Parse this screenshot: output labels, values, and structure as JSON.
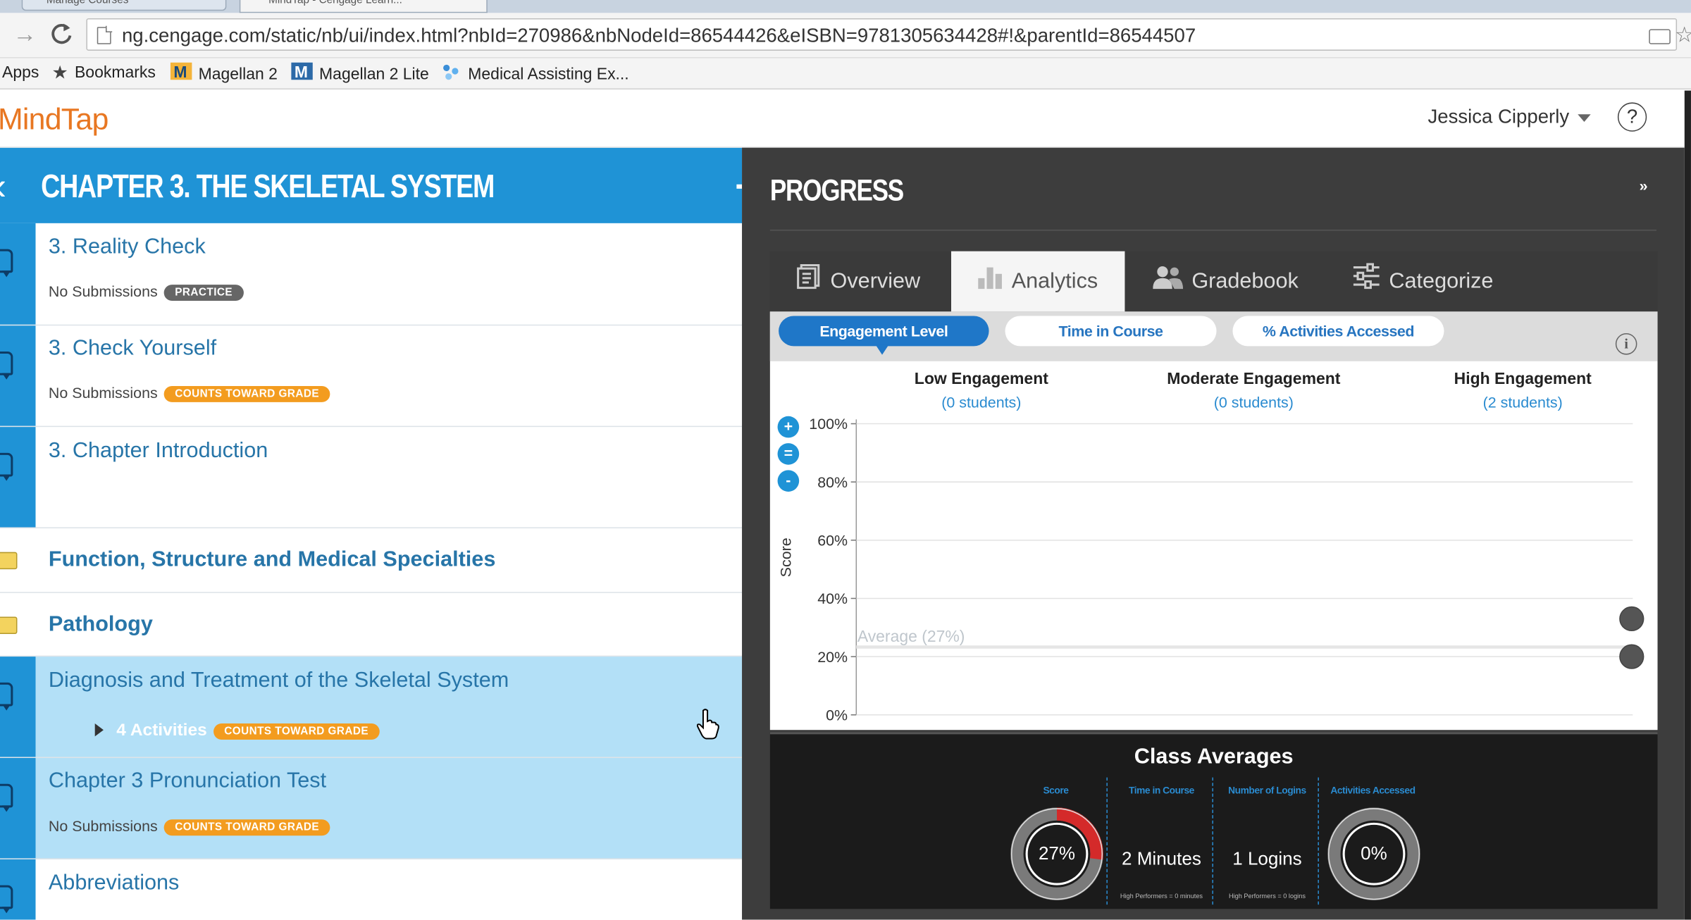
{
  "browser": {
    "tabs": [
      "Manage Courses",
      "MindTap - Cengage Learn..."
    ],
    "url": "ng.cengage.com/static/nb/ui/index.html?nbId=270986&nbNodeId=86544426&eISBN=9781305634428#!&parentId=86544507",
    "bookmarks": [
      {
        "label": "Apps",
        "icon": "apps-icon"
      },
      {
        "label": "Bookmarks",
        "icon": "star-icon"
      },
      {
        "label": "Magellan 2",
        "icon": "magellan-icon"
      },
      {
        "label": "Magellan 2 Lite",
        "icon": "magellan-lite-icon"
      },
      {
        "label": "Medical Assisting Ex...",
        "icon": "medical-assisting-icon"
      }
    ]
  },
  "header": {
    "logo": "MindTap",
    "user_name": "Jessica Cipperly",
    "help": "?"
  },
  "chapter": {
    "title": "CHAPTER 3. THE SKELETAL SYSTEM",
    "items": [
      {
        "name": "3. Reality Check",
        "sub": "No Submissions",
        "badge": "PRACTICE"
      },
      {
        "name": "3. Check Yourself",
        "sub": "No Submissions",
        "badge": "COUNTS TOWARD GRADE"
      },
      {
        "name": "3. Chapter Introduction"
      },
      {
        "name": "Function, Structure and Medical Specialties"
      },
      {
        "name": "Pathology"
      },
      {
        "name": "Diagnosis and Treatment of the Skeletal System",
        "activities": "4 Activities",
        "badge": "COUNTS TOWARD GRADE"
      },
      {
        "name": "Chapter 3 Pronunciation Test",
        "sub": "No Submissions",
        "badge": "COUNTS TOWARD GRADE"
      },
      {
        "name": "Abbreviations"
      }
    ]
  },
  "progress": {
    "title": "PROGRESS",
    "tabs": [
      "Overview",
      "Analytics",
      "Gradebook",
      "Categorize"
    ],
    "active_tab": "Analytics",
    "subtabs": [
      "Engagement Level",
      "Time in Course",
      "% Activities Accessed"
    ],
    "columns": [
      {
        "title": "Low Engagement",
        "count": "(0 students)"
      },
      {
        "title": "Moderate Engagement",
        "count": "(0 students)"
      },
      {
        "title": "High Engagement",
        "count": "(2 students)"
      }
    ],
    "zoom": [
      "+",
      "=",
      "-"
    ],
    "class_averages": {
      "title": "Class Averages",
      "score_label": "Score",
      "score_value": "27%",
      "score_fraction": 0.27,
      "time_label": "Time in Course",
      "time_value": "2 Minutes",
      "time_note": "High Performers = 0 minutes",
      "logins_label": "Number of Logins",
      "logins_value": "1 Logins",
      "logins_note": "High Performers = 0 logins",
      "activities_label": "Activities Accessed",
      "activities_value": "0%",
      "activities_fraction": 0
    }
  },
  "chart_data": {
    "type": "scatter",
    "ylabel": "Score",
    "ylim": [
      0,
      100
    ],
    "yticks": [
      "0%",
      "20%",
      "40%",
      "60%",
      "80%",
      "100%"
    ],
    "ytick_values": [
      0,
      20,
      40,
      60,
      80,
      100
    ],
    "average_label": "Average (27%)",
    "average": 27,
    "points": [
      {
        "group": "High Engagement",
        "y": 33
      },
      {
        "group": "High Engagement",
        "y": 20
      }
    ]
  }
}
